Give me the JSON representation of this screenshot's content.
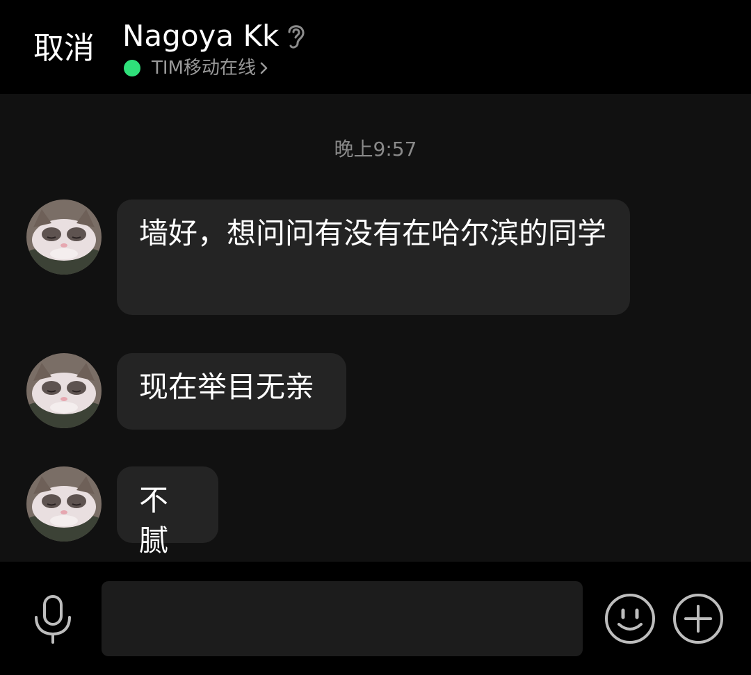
{
  "header": {
    "cancel_label": "取消",
    "contact_name": "Nagoya Kk",
    "ear_icon": "ear-icon",
    "status": {
      "text": "TIM移动在线",
      "dot_color": "#2fe07a",
      "chevron_icon": "chevron-right-icon"
    }
  },
  "chat": {
    "timestamp": "晚上9:57",
    "messages": [
      {
        "sender": "Nagoya Kk",
        "avatar_icon": "cat-avatar",
        "text": "墙好，想问问有没有在哈尔滨的同学"
      },
      {
        "sender": "Nagoya Kk",
        "avatar_icon": "cat-avatar",
        "text": "现在举目无亲"
      },
      {
        "sender": "Nagoya Kk",
        "avatar_icon": "cat-avatar",
        "text": "不腻"
      }
    ]
  },
  "input_bar": {
    "mic_icon": "microphone-icon",
    "input_value": "",
    "input_placeholder": "",
    "emoji_icon": "smiley-icon",
    "plus_icon": "plus-circle-icon"
  },
  "colors": {
    "header_bg": "#000000",
    "chat_bg": "#111111",
    "bubble_bg": "#242424",
    "status_green": "#2fe07a",
    "timestamp_gray": "#8a8a8a"
  }
}
